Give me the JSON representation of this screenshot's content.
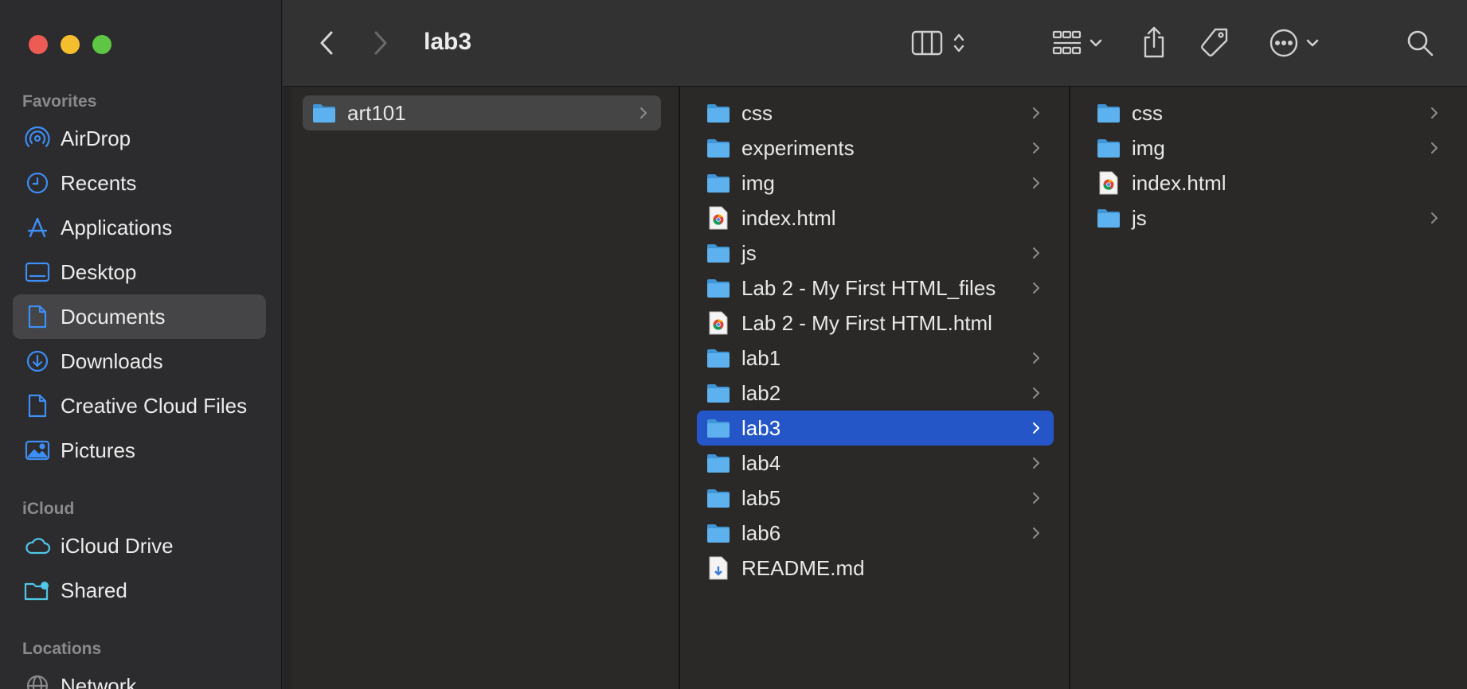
{
  "window": {
    "title": "lab3"
  },
  "sidebar": {
    "sections": [
      {
        "title": "Favorites",
        "items": [
          {
            "label": "AirDrop",
            "icon": "airdrop-icon"
          },
          {
            "label": "Recents",
            "icon": "clock-icon"
          },
          {
            "label": "Applications",
            "icon": "applications-icon"
          },
          {
            "label": "Desktop",
            "icon": "desktop-icon"
          },
          {
            "label": "Documents",
            "icon": "document-icon",
            "selected": true
          },
          {
            "label": "Downloads",
            "icon": "download-icon"
          },
          {
            "label": "Creative Cloud Files",
            "icon": "file-icon"
          },
          {
            "label": "Pictures",
            "icon": "pictures-icon"
          }
        ]
      },
      {
        "title": "iCloud",
        "items": [
          {
            "label": "iCloud Drive",
            "icon": "cloud-icon"
          },
          {
            "label": "Shared",
            "icon": "shared-folder-icon"
          }
        ]
      },
      {
        "title": "Locations",
        "items": [
          {
            "label": "Network",
            "icon": "network-icon"
          }
        ]
      }
    ]
  },
  "columns": [
    {
      "items": [
        {
          "name": "art101",
          "kind": "folder",
          "has_children": true,
          "selection": "gray"
        }
      ]
    },
    {
      "items": [
        {
          "name": "css",
          "kind": "folder",
          "has_children": true
        },
        {
          "name": "experiments",
          "kind": "folder",
          "has_children": true
        },
        {
          "name": "img",
          "kind": "folder",
          "has_children": true
        },
        {
          "name": "index.html",
          "kind": "html",
          "has_children": false
        },
        {
          "name": "js",
          "kind": "folder",
          "has_children": true
        },
        {
          "name": "Lab 2 - My First HTML_files",
          "kind": "folder",
          "has_children": true
        },
        {
          "name": "Lab 2 - My First HTML.html",
          "kind": "html",
          "has_children": false
        },
        {
          "name": "lab1",
          "kind": "folder",
          "has_children": true
        },
        {
          "name": "lab2",
          "kind": "folder",
          "has_children": true
        },
        {
          "name": "lab3",
          "kind": "folder",
          "has_children": true,
          "selection": "blue"
        },
        {
          "name": "lab4",
          "kind": "folder",
          "has_children": true
        },
        {
          "name": "lab5",
          "kind": "folder",
          "has_children": true
        },
        {
          "name": "lab6",
          "kind": "folder",
          "has_children": true
        },
        {
          "name": "README.md",
          "kind": "markdown",
          "has_children": false
        }
      ]
    },
    {
      "items": [
        {
          "name": "css",
          "kind": "folder",
          "has_children": true
        },
        {
          "name": "img",
          "kind": "folder",
          "has_children": true
        },
        {
          "name": "index.html",
          "kind": "html",
          "has_children": false
        },
        {
          "name": "js",
          "kind": "folder",
          "has_children": true
        }
      ]
    }
  ],
  "colors": {
    "accent": "#2456c8",
    "folder": "#5db1ee",
    "sidebar_icon": "#3d8ef5"
  }
}
